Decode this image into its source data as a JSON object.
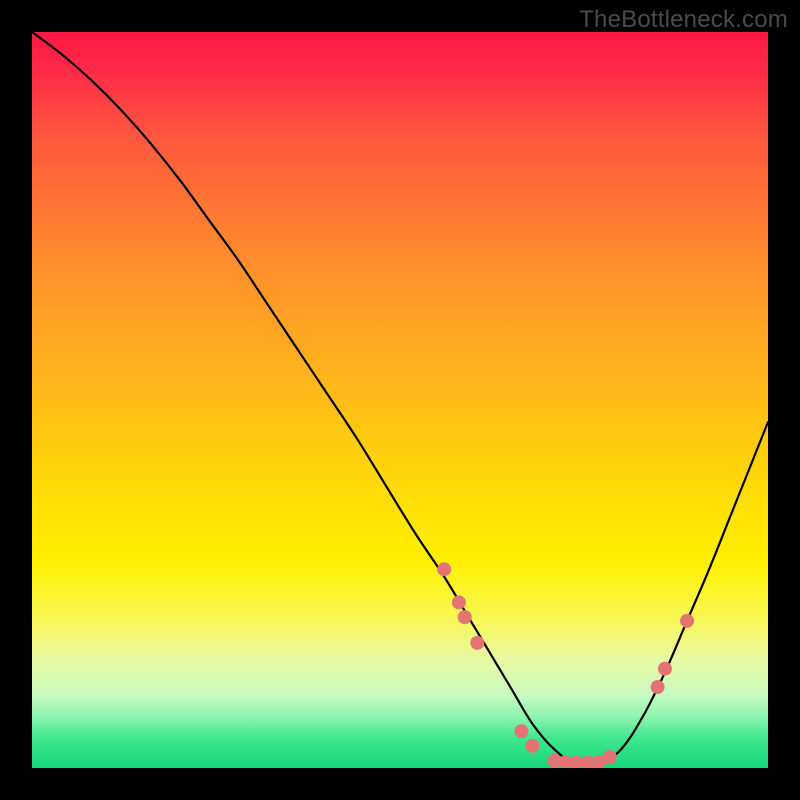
{
  "watermark": "TheBottleneck.com",
  "chart_data": {
    "type": "line",
    "title": "",
    "xlabel": "",
    "ylabel": "",
    "xlim": [
      0,
      100
    ],
    "ylim": [
      0,
      100
    ],
    "grid": false,
    "legend": false,
    "background_gradient": {
      "stops": [
        {
          "offset": 0.0,
          "color": "#ff1744"
        },
        {
          "offset": 0.05,
          "color": "#ff2a48"
        },
        {
          "offset": 0.15,
          "color": "#ff5a3d"
        },
        {
          "offset": 0.3,
          "color": "#ff8a2e"
        },
        {
          "offset": 0.45,
          "color": "#ffb01e"
        },
        {
          "offset": 0.6,
          "color": "#ffd60a"
        },
        {
          "offset": 0.72,
          "color": "#fff000"
        },
        {
          "offset": 0.8,
          "color": "#f8f85a"
        },
        {
          "offset": 0.85,
          "color": "#eaf8a0"
        },
        {
          "offset": 0.9,
          "color": "#c8fbc0"
        },
        {
          "offset": 0.93,
          "color": "#8ef5b0"
        },
        {
          "offset": 0.96,
          "color": "#3ee78e"
        },
        {
          "offset": 1.0,
          "color": "#17d67a"
        }
      ]
    },
    "curve": {
      "x": [
        0,
        4,
        8,
        12,
        16,
        20,
        24,
        28,
        32,
        36,
        40,
        44,
        48,
        52,
        56,
        59,
        62,
        65,
        68,
        71,
        74,
        77,
        80,
        83,
        86,
        89,
        92,
        95,
        98,
        100
      ],
      "y": [
        100,
        97,
        93.5,
        89.5,
        85,
        80,
        74.5,
        69,
        63,
        57,
        51,
        45,
        38.5,
        32,
        26,
        21,
        16,
        11,
        6,
        2.5,
        0.5,
        0.5,
        2.5,
        7,
        13,
        20,
        27,
        34.5,
        42,
        47
      ]
    },
    "dots": {
      "color": "#e57373",
      "radius_px": 7,
      "points": [
        {
          "x": 56.0,
          "y": 27.0
        },
        {
          "x": 58.0,
          "y": 22.5
        },
        {
          "x": 58.8,
          "y": 20.5
        },
        {
          "x": 60.5,
          "y": 17.0
        },
        {
          "x": 66.5,
          "y": 5.0
        },
        {
          "x": 68.0,
          "y": 3.0
        },
        {
          "x": 71.0,
          "y": 1.0
        },
        {
          "x": 72.5,
          "y": 0.8
        },
        {
          "x": 74.0,
          "y": 0.7
        },
        {
          "x": 75.5,
          "y": 0.7
        },
        {
          "x": 77.0,
          "y": 0.8
        },
        {
          "x": 78.5,
          "y": 1.5
        },
        {
          "x": 85.0,
          "y": 11.0
        },
        {
          "x": 86.0,
          "y": 13.5
        },
        {
          "x": 89.0,
          "y": 20.0
        }
      ]
    }
  }
}
